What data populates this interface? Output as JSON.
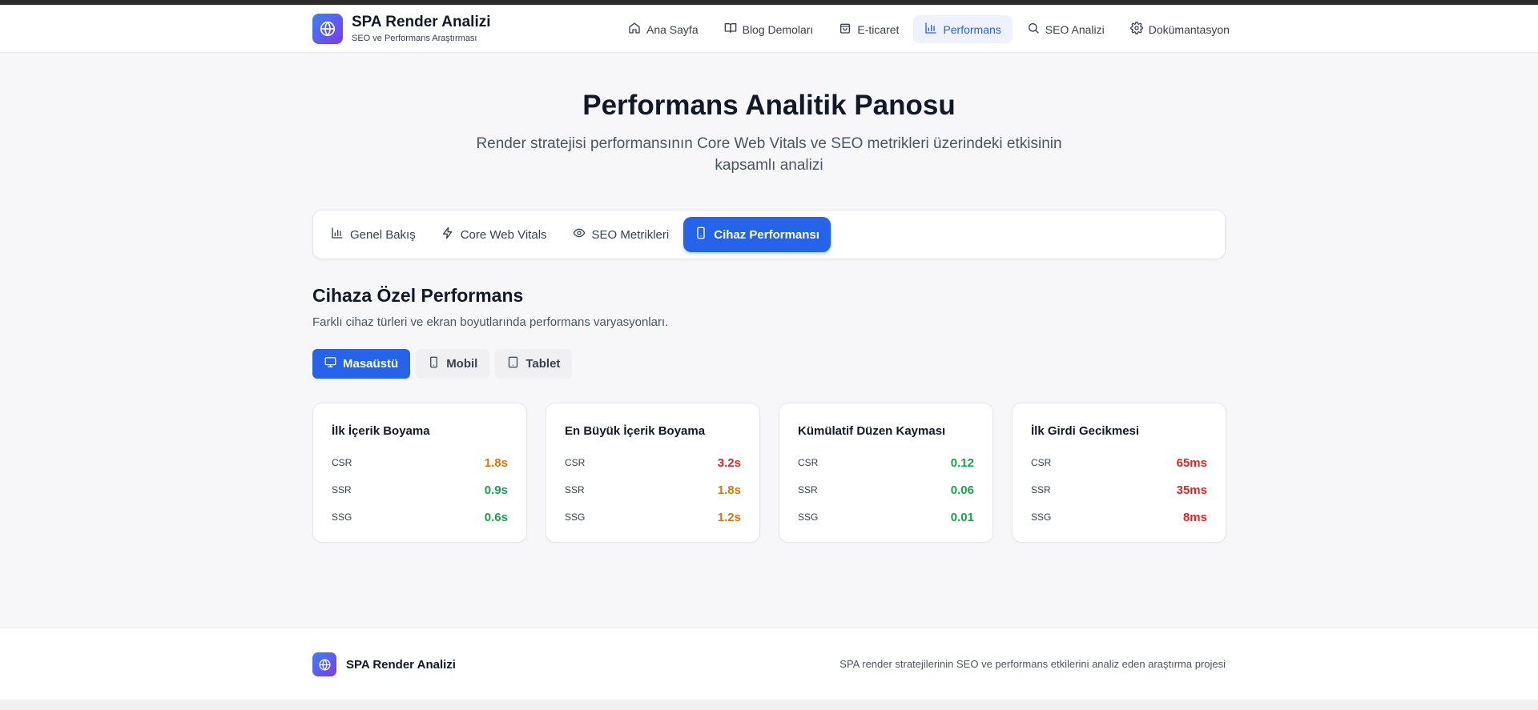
{
  "header": {
    "title": "SPA Render Analizi",
    "subtitle": "SEO ve Performans Araştırması",
    "nav": [
      {
        "label": "Ana Sayfa",
        "icon": "home-icon"
      },
      {
        "label": "Blog Demoları",
        "icon": "book-icon"
      },
      {
        "label": "E-ticaret",
        "icon": "shopping-bag-icon"
      },
      {
        "label": "Performans",
        "icon": "bar-chart-icon",
        "active": true
      },
      {
        "label": "SEO Analizi",
        "icon": "search-icon"
      },
      {
        "label": "Dokümantasyon",
        "icon": "gear-icon"
      }
    ]
  },
  "hero": {
    "title": "Performans Analitik Panosu",
    "subtitle": "Render stratejisi performansının Core Web Vitals ve SEO metrikleri üzerindeki etkisinin kapsamlı analizi"
  },
  "tabs": [
    {
      "label": "Genel Bakış",
      "icon": "bar-chart-icon"
    },
    {
      "label": "Core Web Vitals",
      "icon": "lightning-icon"
    },
    {
      "label": "SEO Metrikleri",
      "icon": "eye-icon"
    },
    {
      "label": "Cihaz Performansı",
      "icon": "smartphone-icon",
      "active": true
    }
  ],
  "section": {
    "title": "Cihaza Özel Performans",
    "subtitle": "Farklı cihaz türleri ve ekran boyutlarında performans varyasyonları."
  },
  "device_tabs": [
    {
      "label": "Masaüstü",
      "icon": "monitor-icon",
      "active": true
    },
    {
      "label": "Mobil",
      "icon": "smartphone-icon"
    },
    {
      "label": "Tablet",
      "icon": "tablet-icon"
    }
  ],
  "cards": [
    {
      "title": "İlk İçerik Boyama",
      "rows": [
        {
          "label": "CSR",
          "value": "1.8s"
        },
        {
          "label": "SSR",
          "value": "0.9s"
        },
        {
          "label": "SSG",
          "value": "0.6s"
        }
      ]
    },
    {
      "title": "En Büyük İçerik Boyama",
      "rows": [
        {
          "label": "CSR",
          "value": "3.2s"
        },
        {
          "label": "SSR",
          "value": "1.8s"
        },
        {
          "label": "SSG",
          "value": "1.2s"
        }
      ]
    },
    {
      "title": "Kümülatif Düzen Kayması",
      "rows": [
        {
          "label": "CSR",
          "value": "0.12"
        },
        {
          "label": "SSR",
          "value": "0.06"
        },
        {
          "label": "SSG",
          "value": "0.01"
        }
      ]
    },
    {
      "title": "İlk Girdi Gecikmesi",
      "rows": [
        {
          "label": "CSR",
          "value": "65ms"
        },
        {
          "label": "SSR",
          "value": "35ms"
        },
        {
          "label": "SSG",
          "value": "8ms"
        }
      ]
    }
  ],
  "colors": {
    "accent": "#2563eb",
    "good": "#16a34a",
    "warn": "#d97706",
    "bad": "#dc2626"
  },
  "footer": {
    "title": "SPA Render Analizi",
    "description": "SPA render stratejilerinin SEO ve performans etkilerini analiz eden araştırma projesi"
  }
}
